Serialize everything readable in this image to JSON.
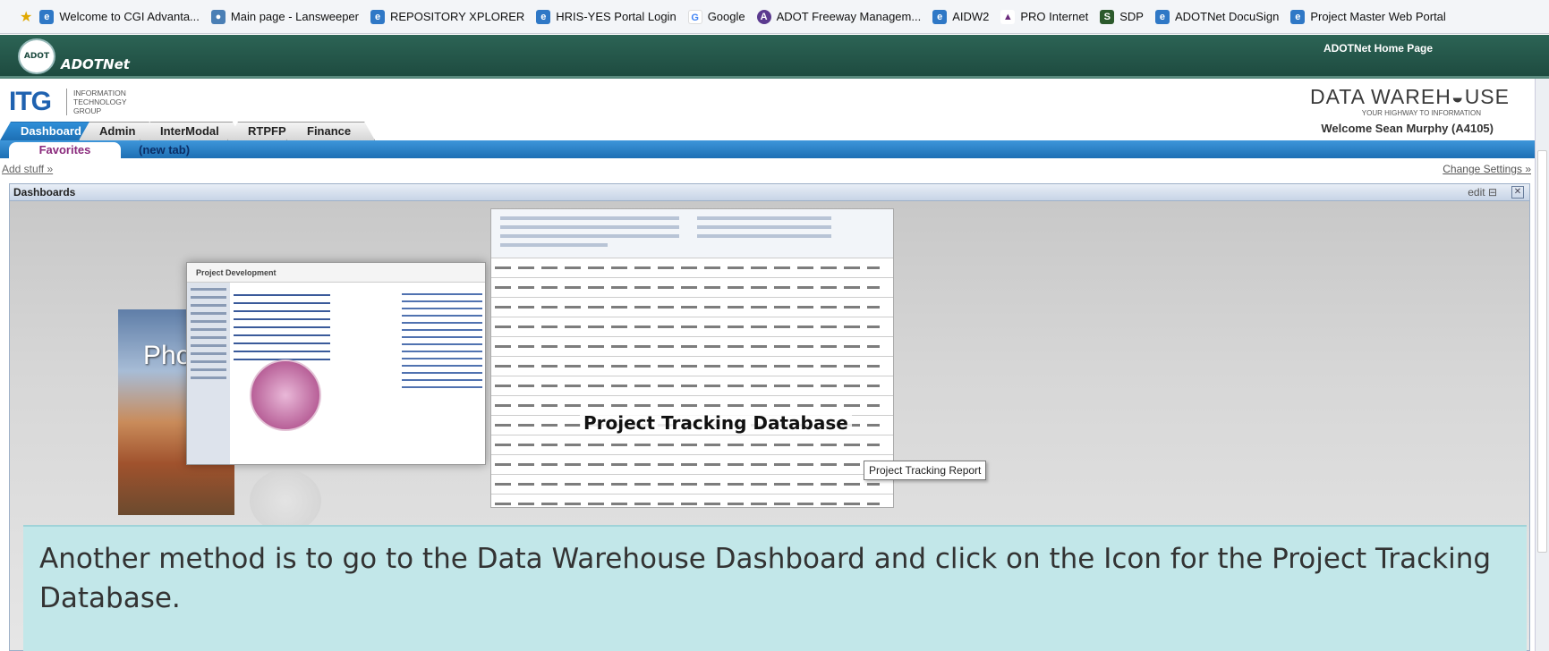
{
  "favorites_bar": {
    "items": [
      {
        "label": "Welcome to CGI Advanta...",
        "icon": "ie-icon"
      },
      {
        "label": "Main page - Lansweeper",
        "icon": "lansweeper-icon"
      },
      {
        "label": "REPOSITORY XPLORER",
        "icon": "ie-icon"
      },
      {
        "label": "HRIS-YES Portal Login",
        "icon": "ie-icon"
      },
      {
        "label": "Google",
        "icon": "google-icon"
      },
      {
        "label": "ADOT Freeway Managem...",
        "icon": "adot-icon"
      },
      {
        "label": "AIDW2",
        "icon": "ie-icon"
      },
      {
        "label": "PRO Internet",
        "icon": "pro-icon"
      },
      {
        "label": "SDP",
        "icon": "sdp-icon"
      },
      {
        "label": "ADOTNet DocuSign",
        "icon": "ie-icon"
      },
      {
        "label": "Project Master Web Portal",
        "icon": "ie-icon"
      }
    ]
  },
  "banner": {
    "brand": "ADOTNet",
    "home_link": "ADOTNet Home Page",
    "logo_text": "ADOT"
  },
  "itg": {
    "logo": "ITG",
    "subtitle_1": "INFORMATION",
    "subtitle_2": "TECHNOLOGY",
    "subtitle_3": "GROUP"
  },
  "data_warehouse": {
    "title": "DATA WAREH◒USE",
    "tagline": "YOUR HIGHWAY TO INFORMATION",
    "welcome": "Welcome Sean Murphy (A4105)"
  },
  "tabs": [
    "Dashboard",
    "Admin",
    "InterModal",
    "RTPFP",
    "Finance"
  ],
  "subtabs": [
    "Favorites",
    "(new tab)"
  ],
  "links": {
    "add_stuff": "Add stuff »",
    "change_settings": "Change Settings »"
  },
  "dashboard": {
    "title": "Dashboards",
    "edit": "edit",
    "project_development_title": "Project Development",
    "photo_label": "Pho",
    "project_tracking_label": "Project Tracking Database",
    "tooltip": "Project Tracking Report"
  },
  "caption": "Another method is to go to the Data Warehouse Dashboard and click on the Icon for the Project Tracking Database.",
  "colors": {
    "banner": "#1e4b40",
    "tab_active": "#1d6fb4",
    "caption_bg": "#c2e7e9",
    "favorites_text": "#8a2a7c"
  }
}
